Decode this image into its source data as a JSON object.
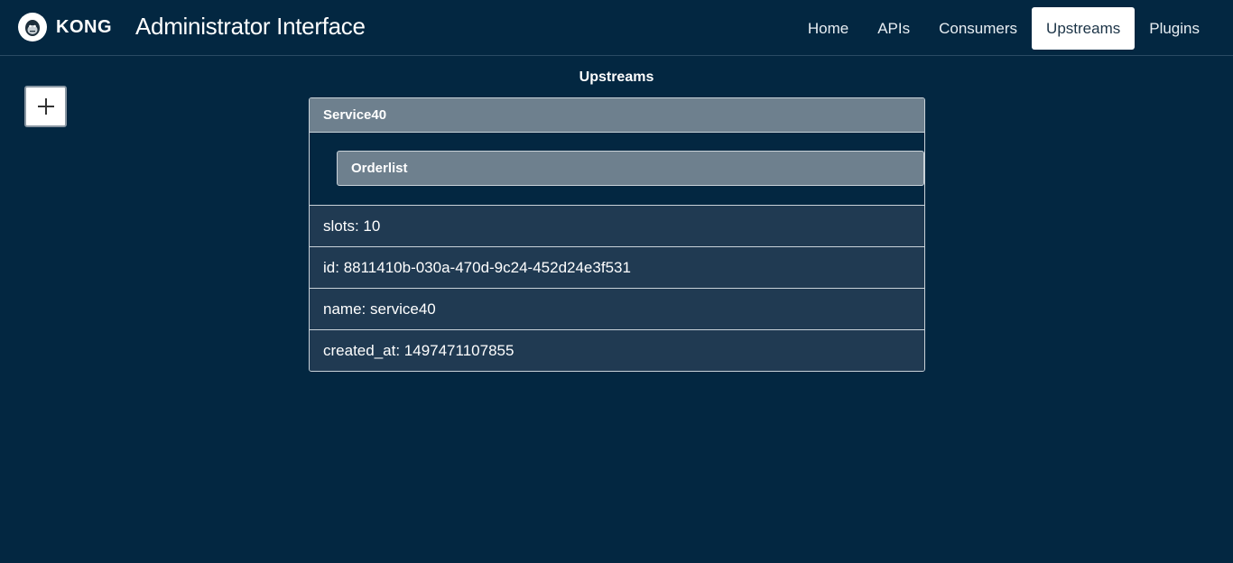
{
  "header": {
    "brand": "KONG",
    "title": "Administrator Interface",
    "nav": [
      {
        "label": "Home",
        "active": false
      },
      {
        "label": "APIs",
        "active": false
      },
      {
        "label": "Consumers",
        "active": false
      },
      {
        "label": "Upstreams",
        "active": true
      },
      {
        "label": "Plugins",
        "active": false
      }
    ]
  },
  "page": {
    "section_title": "Upstreams",
    "add_icon": "plus-icon"
  },
  "upstream": {
    "header": "Service40",
    "sub_header": "Orderlist",
    "fields": [
      {
        "key": "slots:",
        "value": "10"
      },
      {
        "key": "id:",
        "value": "8811410b-030a-470d-9c24-452d24e3f531"
      },
      {
        "key": "name:",
        "value": "service40"
      },
      {
        "key": "created_at:",
        "value": "1497471107855"
      }
    ]
  },
  "colors": {
    "background": "#032741",
    "panel_header": "#6e808e",
    "row_background": "#203a52",
    "border": "#c9d2d9"
  }
}
